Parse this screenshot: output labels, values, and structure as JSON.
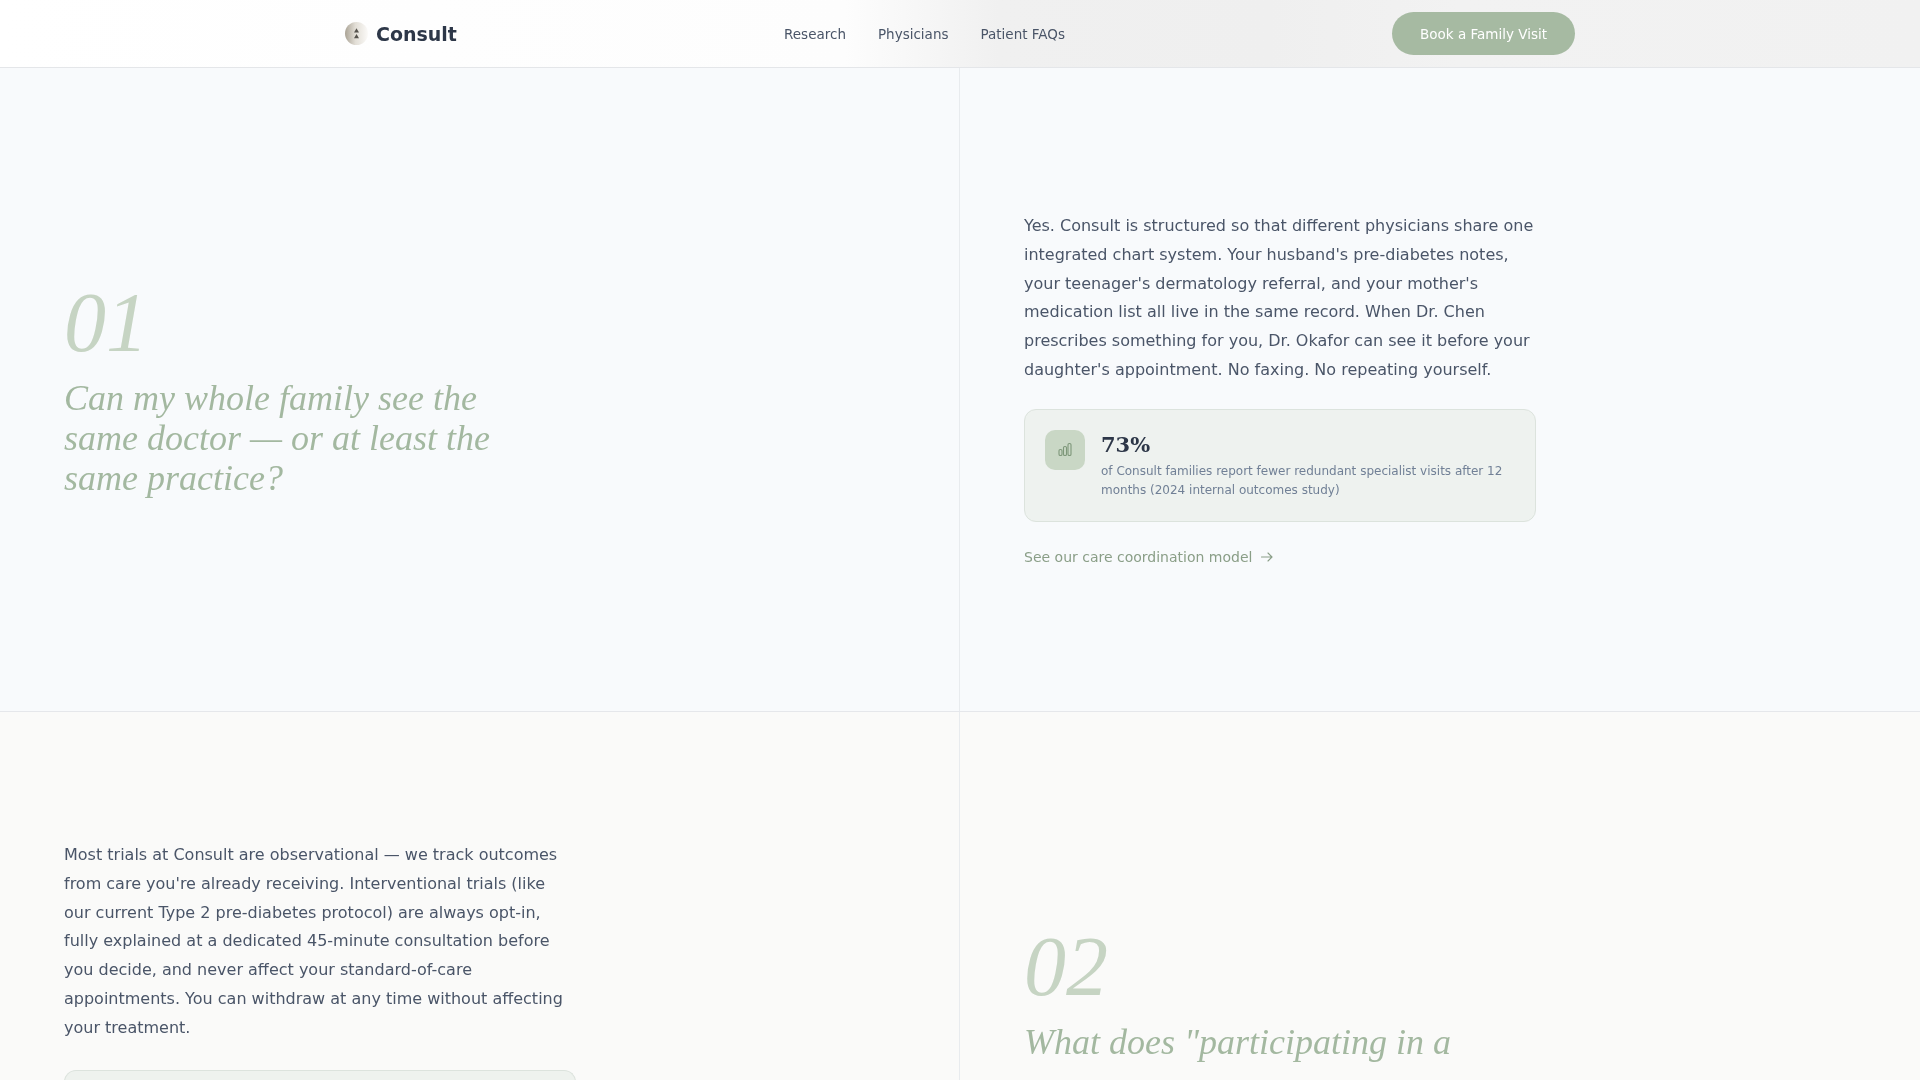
{
  "header": {
    "brand": "Consult",
    "nav": [
      {
        "label": "Research"
      },
      {
        "label": "Physicians"
      },
      {
        "label": "Patient FAQs"
      }
    ],
    "cta": "Book a Family Visit"
  },
  "faqs": [
    {
      "kind": "normal",
      "number": "01",
      "question": "Can my whole family see the same doctor — or at least the same practice?",
      "answer": "Yes. Consult is structured so that different physicians share one integrated chart system. Your husband's pre-diabetes notes, your teenager's dermatology referral, and your mother's medication list all live in the same record. When Dr. Chen prescribes something for you, Dr. Okafor can see it before your daughter's appointment. No faxing. No repeating yourself.",
      "stat": {
        "clipped": false,
        "value": "73%",
        "description": "of Consult families report fewer redundant specialist visits after 12 months (2024 internal outcomes study)"
      },
      "link": "See our care coordination model"
    },
    {
      "kind": "mirrored",
      "number": "02",
      "question": "What does \"participating in a",
      "answer": "Most trials at Consult are observational — we track outcomes from care you're already receiving. Interventional trials (like our current Type 2 pre-diabetes protocol) are always opt-in, fully explained at a dedicated 45-minute consultation before you decide, and never affect your standard-of-care appointments. You can withdraw at any time without affecting your treatment.",
      "stat": {
        "clipped": true
      }
    }
  ]
}
